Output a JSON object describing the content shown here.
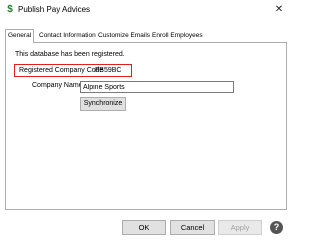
{
  "window": {
    "title": "Publish Pay Advices",
    "icon": "dollar-icon",
    "close_glyph": "✕"
  },
  "tabs": [
    {
      "label": "General",
      "active": true
    },
    {
      "label": "Contact Information",
      "active": false
    },
    {
      "label": "Customize Emails",
      "active": false
    },
    {
      "label": "Enroll Employees",
      "active": false
    }
  ],
  "general": {
    "registered_message": "This database has been registered.",
    "code_label": "Registered Company Code",
    "code_value": "FB59BC",
    "company_name_label": "Company Name",
    "company_name_value": "Alpine Sports",
    "synchronize_label": "Synchronize"
  },
  "footer": {
    "ok_label": "OK",
    "cancel_label": "Cancel",
    "apply_label": "Apply",
    "help_glyph": "?"
  },
  "colors": {
    "highlight_border": "#e0201f",
    "disabled_text": "#a0a0a0"
  }
}
